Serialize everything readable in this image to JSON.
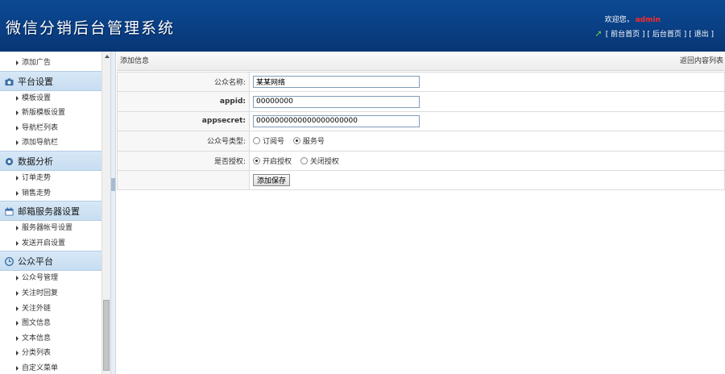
{
  "header": {
    "title": "微信分销后台管理系统",
    "welcome": "欢迎您，",
    "username": "admin",
    "links": [
      "[ 前台首页 ]",
      "[ 后台首页 ]",
      "[ 退出 ]"
    ]
  },
  "sidebar": {
    "items": [
      {
        "kind": "item",
        "label": "添加广告"
      },
      {
        "kind": "group",
        "label": "平台设置",
        "icon": "camera-icon"
      },
      {
        "kind": "item",
        "label": "模板设置"
      },
      {
        "kind": "item",
        "label": "新版模板设置"
      },
      {
        "kind": "item",
        "label": "导航栏列表"
      },
      {
        "kind": "item",
        "label": "添加导航栏"
      },
      {
        "kind": "group",
        "label": "数据分析",
        "icon": "gear-icon"
      },
      {
        "kind": "item",
        "label": "订单走势"
      },
      {
        "kind": "item",
        "label": "销售走势"
      },
      {
        "kind": "group",
        "label": "邮箱服务器设置",
        "icon": "calendar-icon"
      },
      {
        "kind": "item",
        "label": "服务器帐号设置"
      },
      {
        "kind": "item",
        "label": "发送开启设置"
      },
      {
        "kind": "group",
        "label": "公众平台",
        "icon": "clock-icon"
      },
      {
        "kind": "item",
        "label": "公众号管理"
      },
      {
        "kind": "item",
        "label": "关注时回复"
      },
      {
        "kind": "item",
        "label": "关注外链"
      },
      {
        "kind": "item",
        "label": "图文信息"
      },
      {
        "kind": "item",
        "label": "文本信息"
      },
      {
        "kind": "item",
        "label": "分类列表"
      },
      {
        "kind": "item",
        "label": "自定义菜单"
      }
    ]
  },
  "main": {
    "section_title": "添加信息",
    "back_link": "返回内容列表",
    "form": {
      "name_label": "公众名称:",
      "name_value": "某某网络",
      "appid_label": "appid:",
      "appid_value": "00000000",
      "appsecret_label": "appsecret:",
      "appsecret_value": "0000000000000000000000",
      "type_label": "公众号类型:",
      "type_options": [
        "订阅号",
        "服务号"
      ],
      "type_selected": "服务号",
      "auth_label": "是否授权:",
      "auth_options": [
        "开启授权",
        "关闭授权"
      ],
      "auth_selected": "开启授权",
      "submit_label": "添加保存"
    }
  },
  "colors": {
    "header_bg": "#0a3f84",
    "username": "#ff2a2a",
    "group_bg": "#c7ddf1"
  }
}
